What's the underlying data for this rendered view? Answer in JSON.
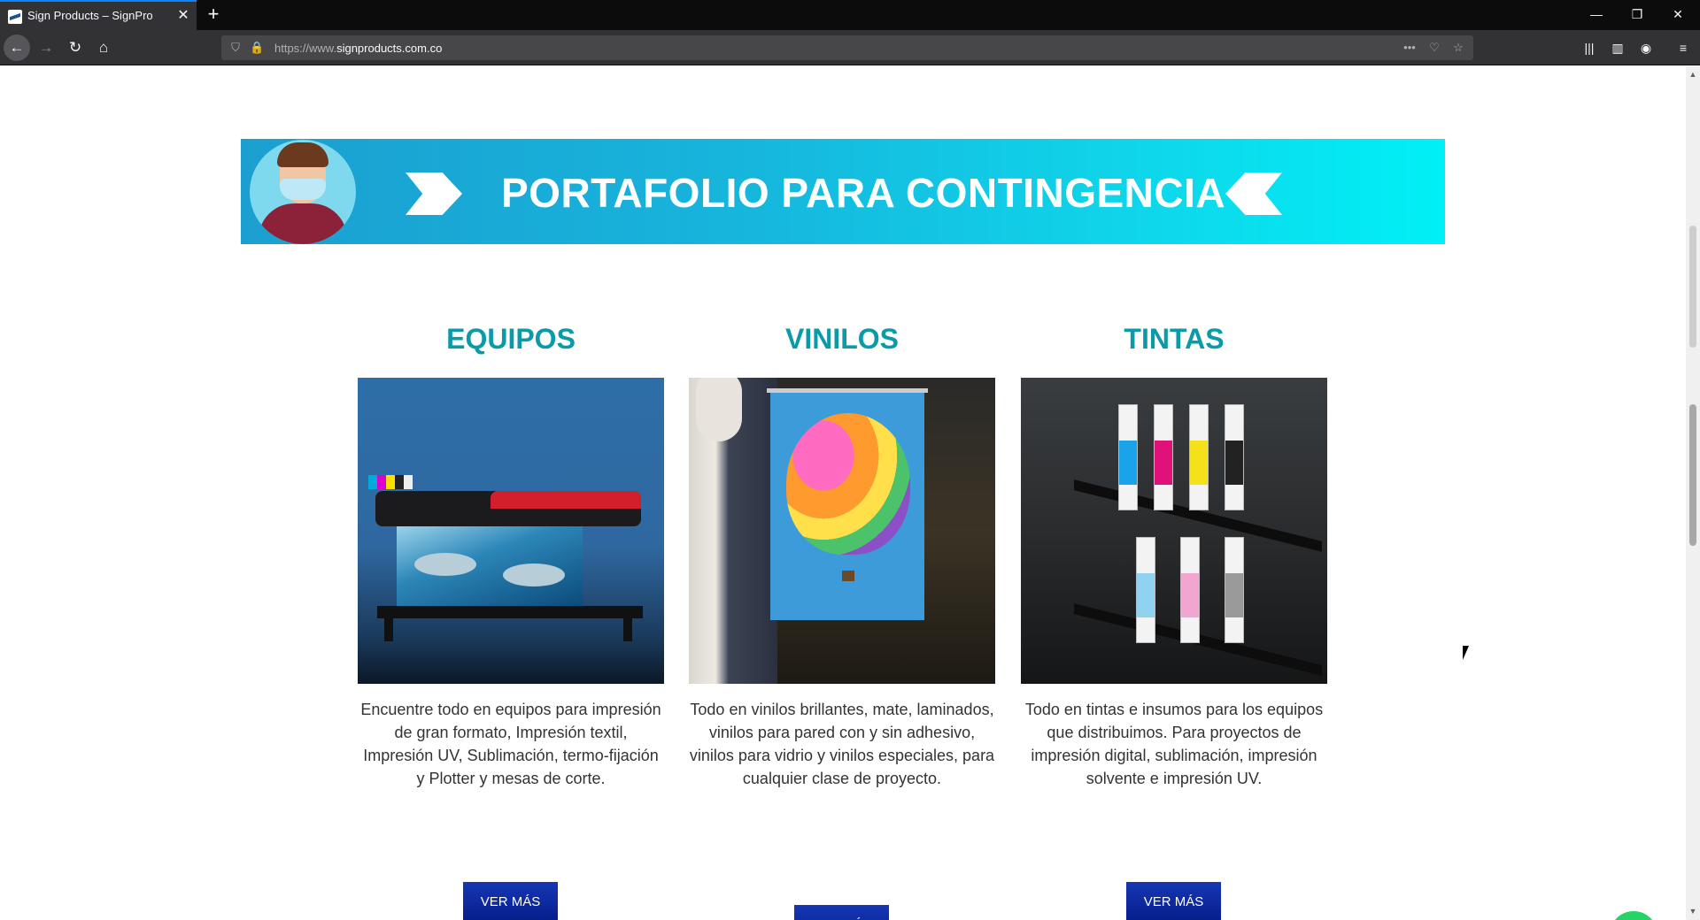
{
  "browser": {
    "tab_title": "Sign Products – SignPro",
    "tab_close_glyph": "✕",
    "new_tab_glyph": "+",
    "url_scheme": "https://www.",
    "url_host": "signproducts.com.co",
    "window_controls": {
      "minimize": "—",
      "restore": "❐",
      "close": "✕"
    },
    "nav": {
      "back": "←",
      "forward": "→",
      "reload": "↻",
      "home": "⌂"
    },
    "url_icons": {
      "shield": "⛉",
      "lock": "🔒",
      "more": "•••",
      "pocket": "♡",
      "star": "☆"
    },
    "toolbar_icons": {
      "library": "|||",
      "sidebar": "▥",
      "account": "◉",
      "menu": "≡"
    }
  },
  "page": {
    "banner": {
      "title": "PORTAFOLIO PARA CONTINGENCIA"
    },
    "cards": [
      {
        "heading": "EQUIPOS",
        "description": "Encuentre todo en equipos para impresión de gran formato, Impresión textil, Impresión UV, Sublimación, termo-fijación y Plotter y mesas de corte.",
        "button": "VER MÁS"
      },
      {
        "heading": "VINILOS",
        "description": "Todo en vinilos brillantes, mate, laminados, vinilos para pared con y sin adhesivo, vinilos para vidrio y vinilos especiales, para cualquier clase de proyecto.",
        "button": "VER MÁS"
      },
      {
        "heading": "TINTAS",
        "description": "Todo en tintas e insumos para los equipos que distribuimos. Para proyectos de impresión digital, sublimación, impresión solvente e impresión UV.",
        "button": "VER MÁS"
      }
    ]
  },
  "colors": {
    "heading_teal": "#0a9aa8",
    "button_blue": "#061e8c",
    "whatsapp_green": "#25d366"
  }
}
